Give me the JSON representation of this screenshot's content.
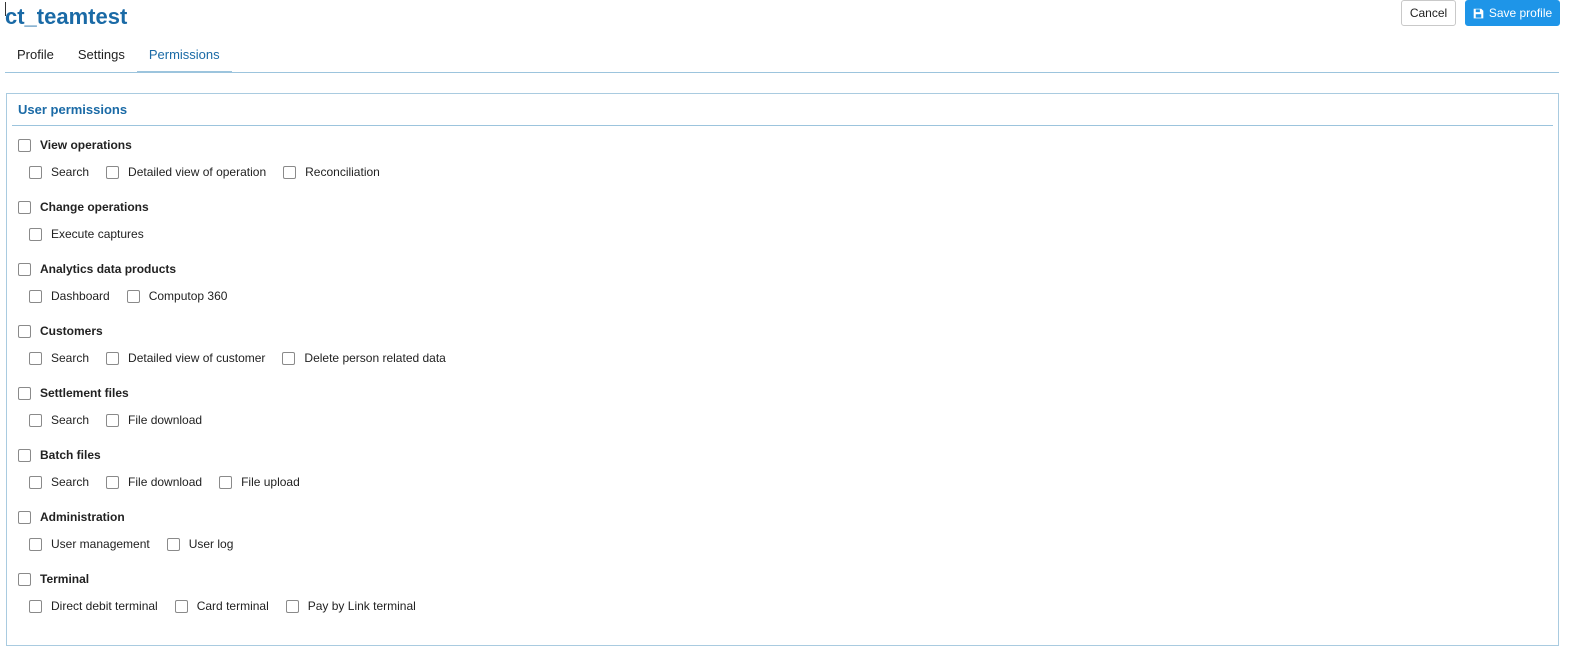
{
  "header": {
    "title": "ct_teamtest",
    "cancel_label": "Cancel",
    "save_label": "Save profile"
  },
  "tabs": [
    {
      "label": "Profile",
      "active": false
    },
    {
      "label": "Settings",
      "active": false
    },
    {
      "label": "Permissions",
      "active": true
    }
  ],
  "panel": {
    "title": "User permissions",
    "groups": [
      {
        "label": "View operations",
        "checked": false,
        "items": [
          {
            "label": "Search",
            "checked": false
          },
          {
            "label": "Detailed view of operation",
            "checked": false
          },
          {
            "label": "Reconciliation",
            "checked": false
          }
        ]
      },
      {
        "label": "Change operations",
        "checked": false,
        "items": [
          {
            "label": "Execute captures",
            "checked": false
          }
        ]
      },
      {
        "label": "Analytics data products",
        "checked": false,
        "items": [
          {
            "label": "Dashboard",
            "checked": false
          },
          {
            "label": "Computop 360",
            "checked": false
          }
        ]
      },
      {
        "label": "Customers",
        "checked": false,
        "items": [
          {
            "label": "Search",
            "checked": false
          },
          {
            "label": "Detailed view of customer",
            "checked": false
          },
          {
            "label": "Delete person related data",
            "checked": false
          }
        ]
      },
      {
        "label": "Settlement files",
        "checked": false,
        "items": [
          {
            "label": "Search",
            "checked": false
          },
          {
            "label": "File download",
            "checked": false
          }
        ]
      },
      {
        "label": "Batch files",
        "checked": false,
        "items": [
          {
            "label": "Search",
            "checked": false
          },
          {
            "label": "File download",
            "checked": false
          },
          {
            "label": "File upload",
            "checked": false
          }
        ]
      },
      {
        "label": "Administration",
        "checked": false,
        "items": [
          {
            "label": "User management",
            "checked": false
          },
          {
            "label": "User log",
            "checked": false
          }
        ]
      },
      {
        "label": "Terminal",
        "checked": false,
        "items": [
          {
            "label": "Direct debit terminal",
            "checked": false
          },
          {
            "label": "Card terminal",
            "checked": false
          },
          {
            "label": "Pay by Link terminal",
            "checked": false
          }
        ]
      }
    ]
  },
  "colors": {
    "accent": "#1a6aa6",
    "primary_button": "#1e95e8",
    "rule": "#9cc4dd"
  },
  "icons": {
    "save": "floppy-disk-icon",
    "checkbox": "checkbox-unchecked"
  }
}
